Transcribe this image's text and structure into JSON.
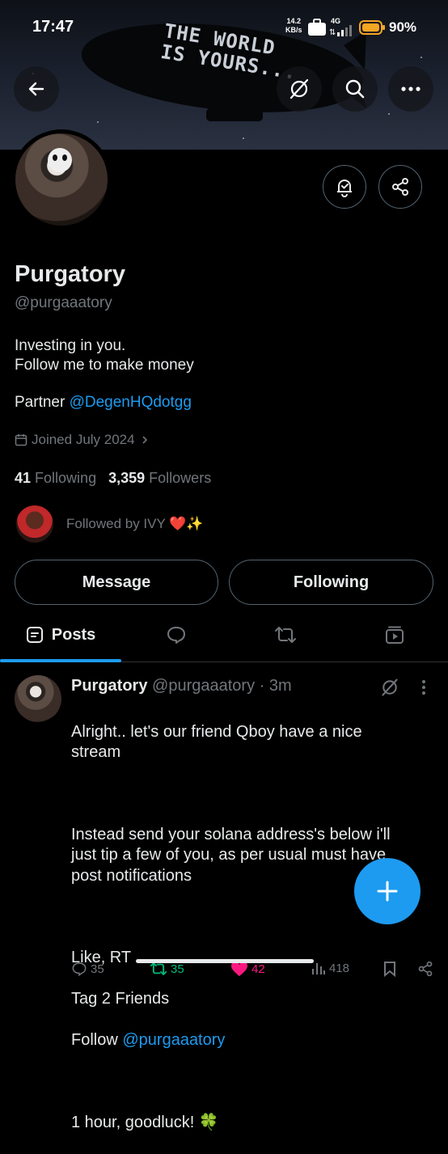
{
  "status_bar": {
    "time": "17:47",
    "net_speed_value": "14.2",
    "net_speed_unit": "KB/s",
    "network": "4G",
    "battery": "90%"
  },
  "banner": {
    "text_line1": "THE WORLD",
    "text_line2": "IS YOURS..."
  },
  "profile": {
    "name": "Purgatory",
    "handle": "@purgaaatory",
    "bio_line1": "Investing in you.",
    "bio_line2": "Follow me to make money",
    "partner_prefix": "Partner ",
    "partner_link": "@DegenHQdotgg",
    "joined": "Joined July 2024",
    "following_count": "41",
    "following_label": "Following",
    "followers_count": "3,359",
    "followers_label": "Followers",
    "followed_by": "Followed by IVY ❤️✨"
  },
  "buttons": {
    "message": "Message",
    "following": "Following"
  },
  "tabs": {
    "posts": "Posts"
  },
  "tweet": {
    "name": "Purgatory",
    "handle": "@purgaaatory",
    "sep": " · ",
    "time": "3m",
    "para1": "Alright.. let's our friend Qboy have a nice stream",
    "para2": "Instead send your solana address's below i'll just tip a few of you, as per usual must have post notifications",
    "para3_l1": "Like, RT",
    "para3_l2": "Tag 2 Friends",
    "para3_l3_prefix": "Follow ",
    "para3_l3_link": "@purgaaatory",
    "para4": "1 hour, goodluck! 🍀",
    "replies": "35",
    "retweets": "35",
    "likes": "42",
    "views": "418"
  },
  "colors": {
    "accent": "#1d9bf0",
    "muted": "#71767b",
    "border": "#536471",
    "retweet": "#00ba7c",
    "like": "#f91880"
  }
}
